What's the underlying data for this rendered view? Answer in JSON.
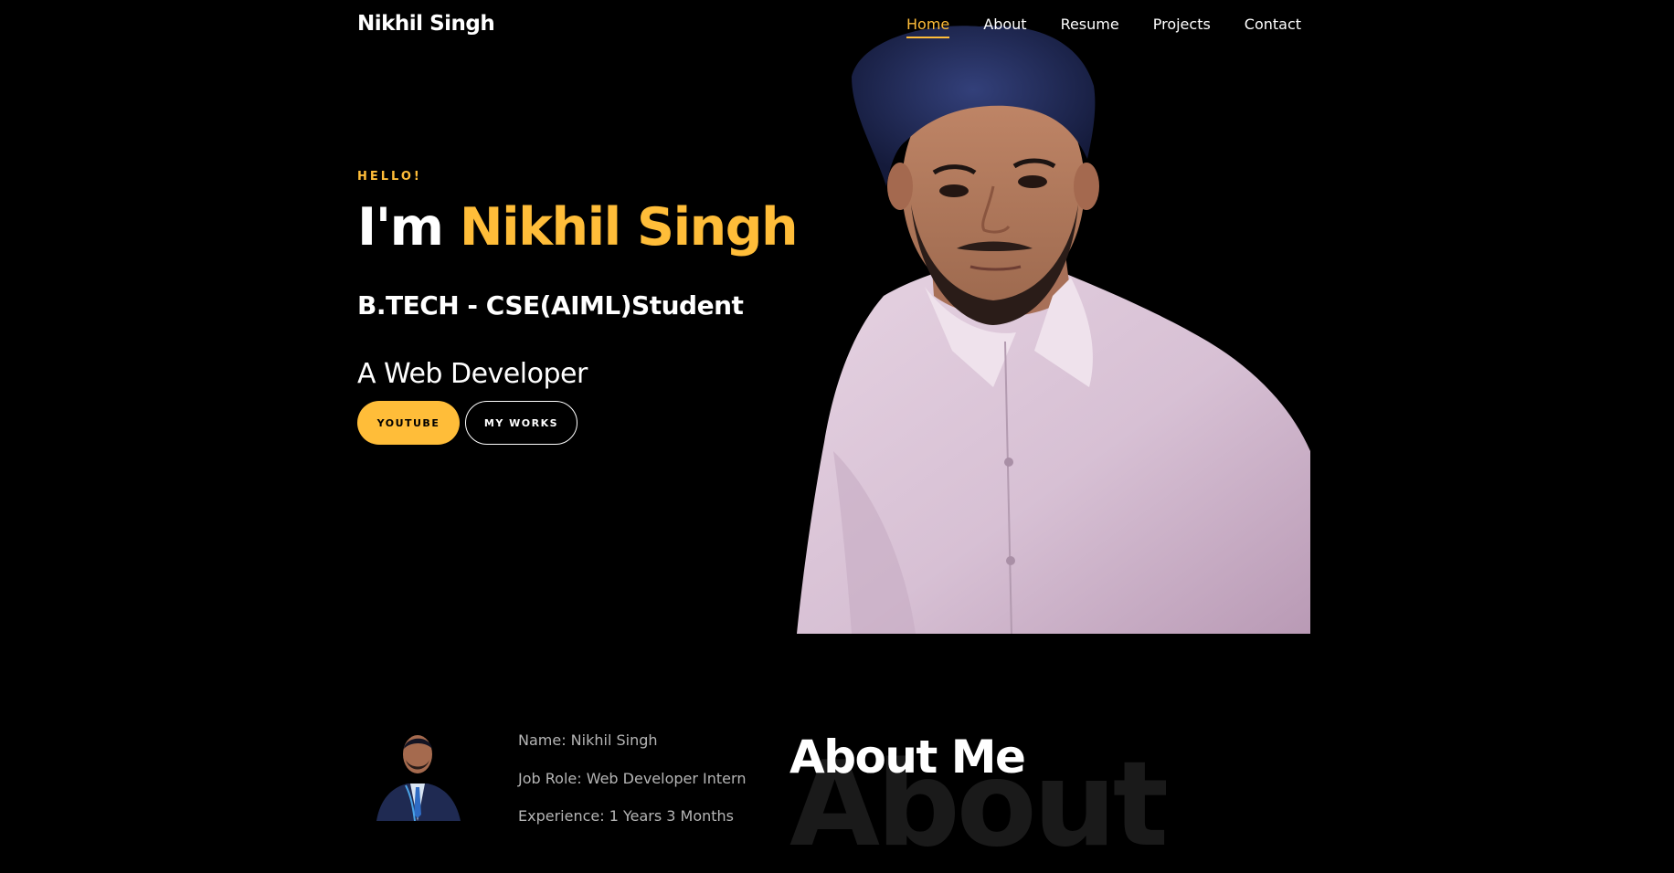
{
  "nav": {
    "logo": "Nikhil Singh",
    "items": [
      {
        "label": "Home",
        "active": true
      },
      {
        "label": "About",
        "active": false
      },
      {
        "label": "Resume",
        "active": false
      },
      {
        "label": "Projects",
        "active": false
      },
      {
        "label": "Contact",
        "active": false
      }
    ]
  },
  "hero": {
    "greeting": "HELLO!",
    "title_prefix": "I'm ",
    "title_name": "Nikhil Singh",
    "subtitle": "B.TECH - CSE(AIML)Student",
    "typed_text": "A Web Developer",
    "buttons": {
      "primary": "YOUTUBE",
      "secondary": "MY WORKS"
    }
  },
  "about": {
    "title": "About Me",
    "background_word": "About",
    "info": [
      "Name: Nikhil Singh",
      "Job Role: Web Developer Intern",
      "Experience: 1 Years 3 Months"
    ]
  },
  "colors": {
    "accent": "#ffbd39",
    "background": "#000000",
    "text": "#ffffff",
    "muted": "#b5b5b5"
  }
}
